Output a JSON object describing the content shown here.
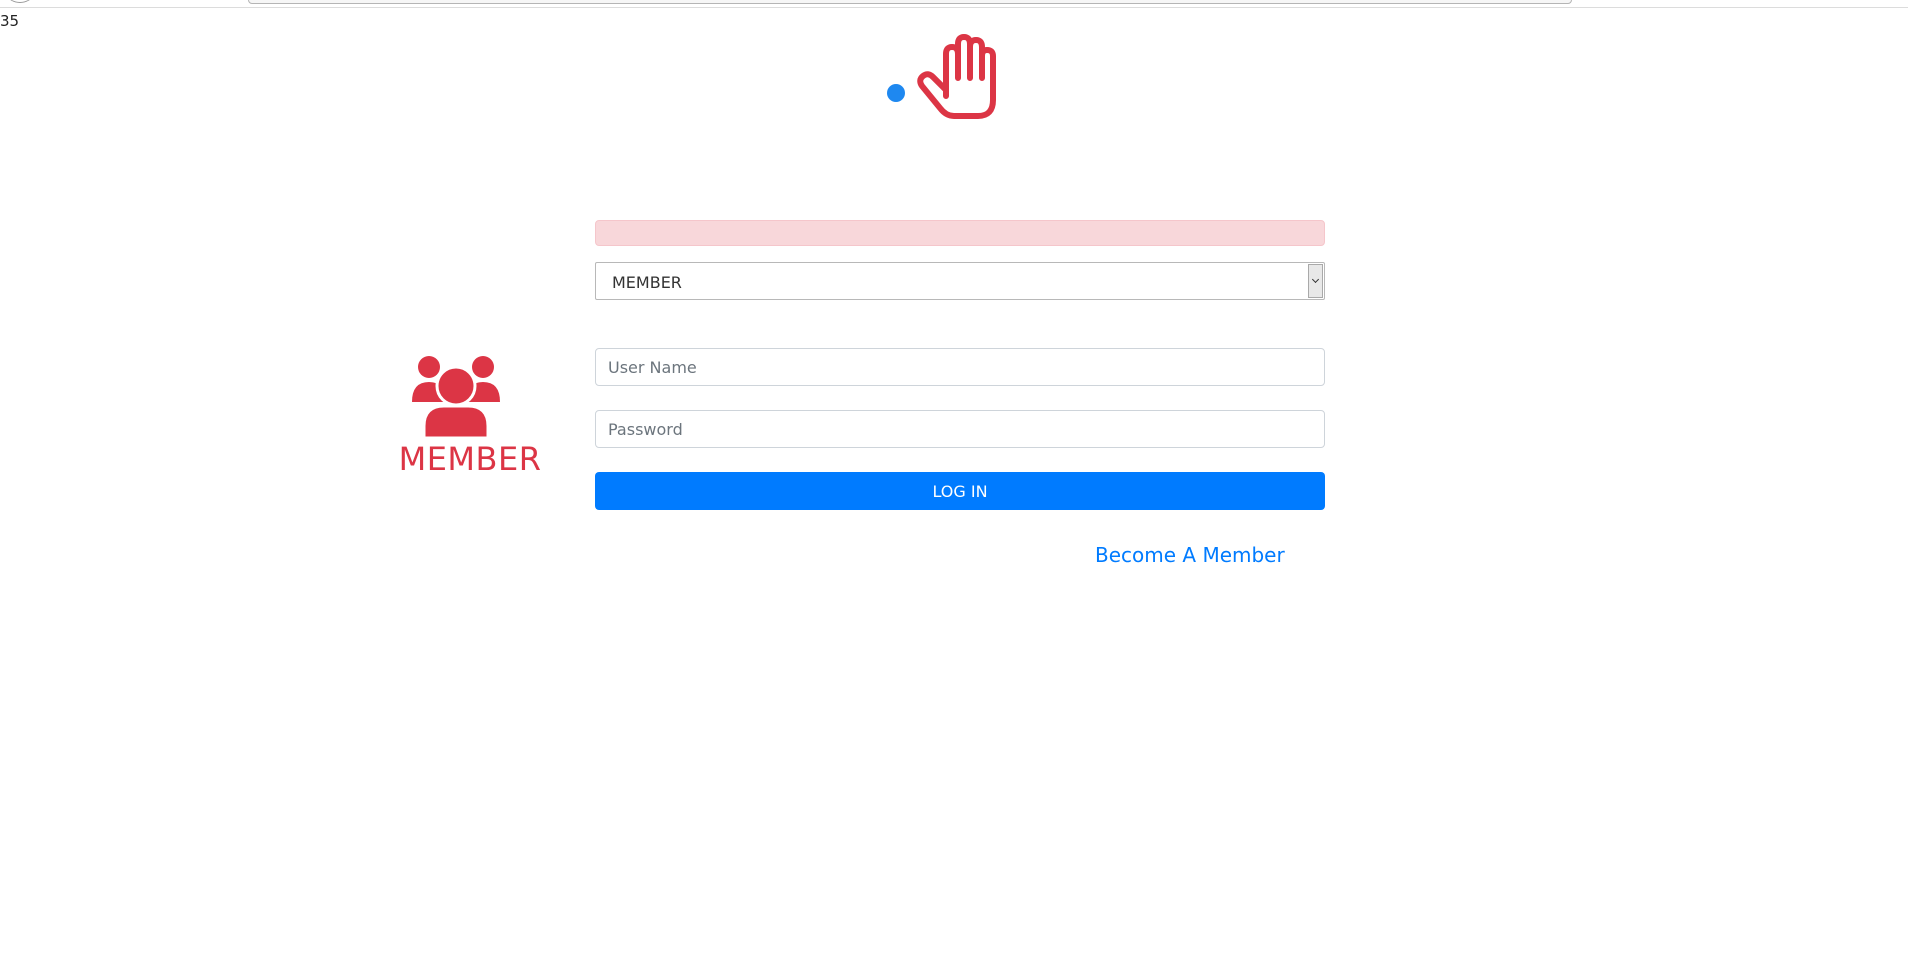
{
  "page": {
    "counter_text": "35"
  },
  "login": {
    "role_label": "MEMBER",
    "role_select_value": "MEMBER",
    "username_placeholder": "User Name",
    "password_placeholder": "Password",
    "login_button_label": "LOG IN",
    "become_member_link": "Become A Member"
  },
  "icons": {
    "hand": "hand-stop-icon",
    "members": "users-group-icon"
  },
  "colors": {
    "accent_red": "#dc3545",
    "primary_blue": "#007bff",
    "alert_background": "#f8d7da",
    "cursor_dot": "#1e88f0"
  }
}
